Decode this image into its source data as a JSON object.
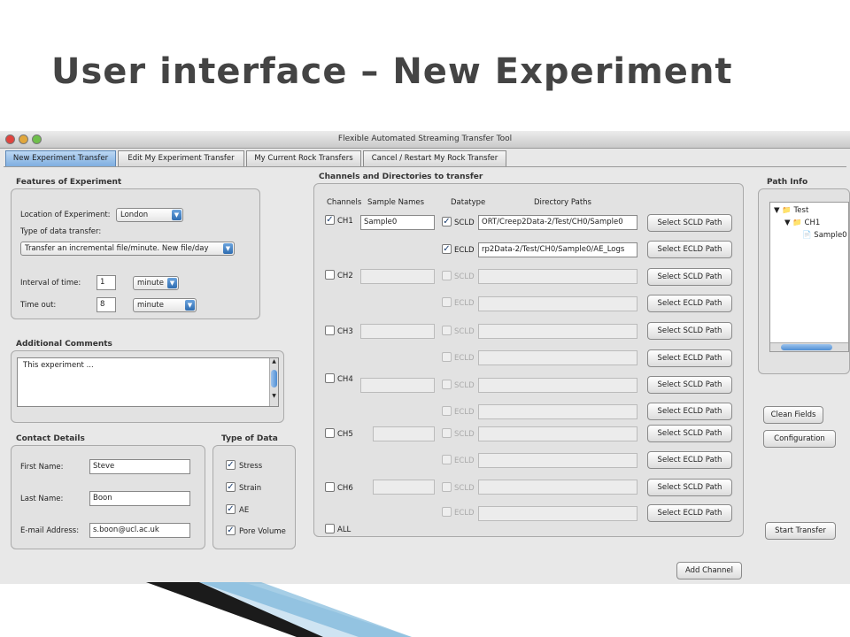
{
  "slide": {
    "title": "User interface – New Experiment"
  },
  "window": {
    "title": "Flexible Automated Streaming Transfer Tool"
  },
  "tabs": [
    {
      "label": "New Experiment Transfer"
    },
    {
      "label": "Edit  My  Experiment Transfer"
    },
    {
      "label": "My Current Rock Transfers"
    },
    {
      "label": "Cancel / Restart My Rock Transfer"
    }
  ],
  "features": {
    "title": "Features of Experiment",
    "location_label": "Location of Experiment:",
    "location_value": "London",
    "transfer_type_label": "Type of data transfer:",
    "transfer_type_value": "Transfer an incremental file/minute. New file/day",
    "interval_label": "Interval of time:",
    "interval_value": "1",
    "interval_unit": "minute",
    "timeout_label": "Time out:",
    "timeout_value": "8",
    "timeout_unit": "minute"
  },
  "comments": {
    "title": "Additional Comments",
    "text": "This experiment ..."
  },
  "contact": {
    "title": "Contact Details",
    "first_label": "First Name:",
    "first_value": "Steve",
    "last_label": "Last Name:",
    "last_value": "Boon",
    "email_label": "E-mail Address:",
    "email_value": "s.boon@ucl.ac.uk"
  },
  "data_types": {
    "title": "Type of Data",
    "items": [
      {
        "label": "Stress",
        "checked": true
      },
      {
        "label": "Strain",
        "checked": true
      },
      {
        "label": "AE",
        "checked": true
      },
      {
        "label": "Pore Volume",
        "checked": true
      }
    ]
  },
  "channels": {
    "title": "Channels and Directories to transfer",
    "col_channels": "Channels",
    "col_sample": "Sample Names",
    "col_datatype": "Datatype",
    "col_paths": "Directory Paths",
    "sclds": "SCLD",
    "eclds": "ECLD",
    "select_scld": "Select SCLD Path",
    "select_ecld": "Select ECLD Path",
    "all_label": "ALL",
    "rows": [
      {
        "name": "CH1",
        "checked": true,
        "sample": "Sample0",
        "scld_path": "ORT/Creep2Data-2/Test/CH0/Sample0",
        "ecld_path": "rp2Data-2/Test/CH0/Sample0/AE_Logs"
      },
      {
        "name": "CH2",
        "checked": false,
        "sample": "",
        "scld_path": "",
        "ecld_path": ""
      },
      {
        "name": "CH3",
        "checked": false,
        "sample": "",
        "scld_path": "",
        "ecld_path": ""
      },
      {
        "name": "CH4",
        "checked": false,
        "sample": "",
        "scld_path": "",
        "ecld_path": ""
      },
      {
        "name": "CH5",
        "checked": false,
        "sample": "",
        "scld_path": "",
        "ecld_path": ""
      },
      {
        "name": "CH6",
        "checked": false,
        "sample": "",
        "scld_path": "",
        "ecld_path": ""
      }
    ]
  },
  "path_info": {
    "title": "Path Info",
    "tree": [
      "Test",
      "CH1",
      "Sample0"
    ]
  },
  "buttons": {
    "clean_fields": "Clean Fields",
    "configuration": "Configuration",
    "start_transfer": "Start Transfer",
    "add_channel": "Add Channel"
  },
  "colors": {
    "accent": "#3a7bc8",
    "title_text": "#444444"
  }
}
